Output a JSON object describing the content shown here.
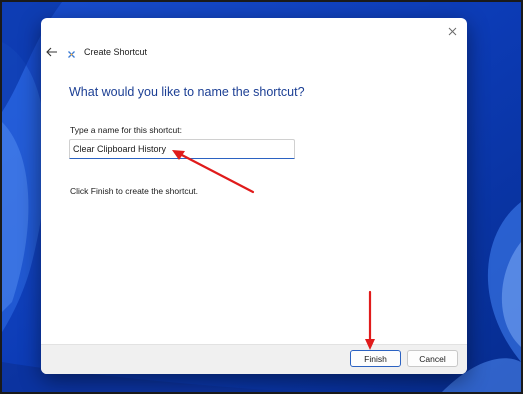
{
  "window": {
    "title": "Create Shortcut",
    "close_icon": "close-icon",
    "back_icon": "back-arrow-icon"
  },
  "content": {
    "question": "What would you like to name the shortcut?",
    "field_label": "Type a name for this shortcut:",
    "name_value": "Clear Clipboard History",
    "finish_hint": "Click Finish to create the shortcut."
  },
  "footer": {
    "finish_label": "Finish",
    "cancel_label": "Cancel"
  },
  "colors": {
    "heading": "#1c3f94",
    "annotation_arrow": "#e01b1b",
    "default_button_border": "#2b62c2"
  }
}
